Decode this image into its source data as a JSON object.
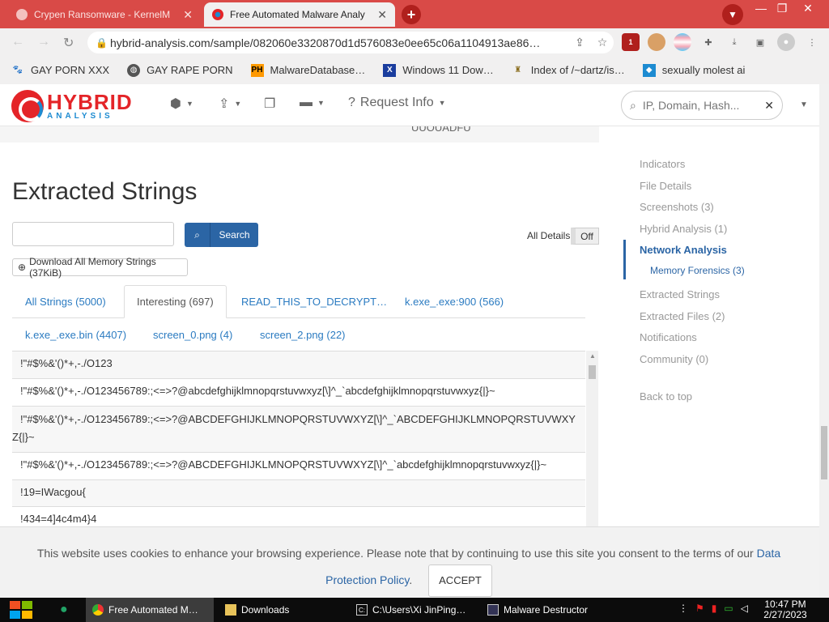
{
  "browser": {
    "tabs": [
      {
        "title": "Crypen Ransomware - KernelM",
        "active": false,
        "close": "✕"
      },
      {
        "title": "Free Automated Malware Analy",
        "active": true,
        "close": "✕"
      }
    ],
    "new_tab": "+",
    "url": "hybrid-analysis.com/sample/082060e3320870d1d576083e0ee65c06a1104913ae86…",
    "window_controls": {
      "minimize": "—",
      "restore": "❐",
      "close": "✕"
    },
    "extension_badge": "1",
    "bookmarks": [
      {
        "label": "GAY PORN XXX",
        "icon": "paw-icon"
      },
      {
        "label": "GAY RAPE PORN",
        "icon": "globe-icon"
      },
      {
        "label": "MalwareDatabase…",
        "icon": "ph-icon",
        "icon_text": "PH"
      },
      {
        "label": "Windows 11 Dow…",
        "icon": "x-icon",
        "icon_text": "X"
      },
      {
        "label": "Index of /~dartz/is…",
        "icon": "trophy-icon"
      },
      {
        "label": "sexually molest ai",
        "icon": "puzzle-icon"
      }
    ]
  },
  "site": {
    "logo_top": "HYBRID",
    "logo_bottom": "ANALYSIS",
    "menu": [
      {
        "icon": "cube-icon",
        "label": ""
      },
      {
        "icon": "file-upload-icon",
        "label": ""
      },
      {
        "icon": "copy-icon",
        "label": ""
      },
      {
        "icon": "folder-icon",
        "label": ""
      },
      {
        "icon": "question-circle-icon",
        "label": "Request Info"
      }
    ],
    "search_placeholder": "IP, Domain, Hash...",
    "search_clear": "✕"
  },
  "main": {
    "stub_text": "UUOUADFU",
    "heading": "Extracted Strings",
    "search_button": "Search",
    "all_details_label": "All Details:",
    "all_details_value": "Off",
    "download_button": "Download All Memory Strings (37KiB)",
    "tabs_row1": [
      {
        "label": "All Strings (5000)",
        "active": false
      },
      {
        "label": "Interesting (697)",
        "active": true
      },
      {
        "label": "READ_THIS_TO_DECRYPT…",
        "active": false
      },
      {
        "label": "k.exe_.exe:900 (566)",
        "active": false
      }
    ],
    "tabs_row2": [
      {
        "label": "k.exe_.exe.bin (4407)"
      },
      {
        "label": "screen_0.png (4)"
      },
      {
        "label": "screen_2.png (22)"
      }
    ],
    "strings": [
      "!\"#$%&'()*+,-./O123",
      "!\"#$%&'()*+,-./O123456789:;<=>?@abcdefghijklmnopqrstuvwxyz[\\]^_`abcdefghijklmnopqrstuvwxyz{|}~",
      "!\"#$%&'()*+,-./O123456789:;<=>?@ABCDEFGHIJKLMNOPQRSTUVWXYZ[\\]^_`ABCDEFGHIJKLMNOPQRSTUVWXYZ{|}~",
      "!\"#$%&'()*+,-./O123456789:;<=>?@ABCDEFGHIJKLMNOPQRSTUVWXYZ[\\]^_`abcdefghijklmnopqrstuvwxyz{|}~",
      "!19=IWacgou{",
      "!434=4]4c4m4}4"
    ]
  },
  "sidenav": {
    "items": [
      "Indicators",
      "File Details",
      "Screenshots (3)",
      "Hybrid Analysis (1)",
      "Network Analysis"
    ],
    "active": "Network Analysis",
    "sub_item": "Memory Forensics (3)",
    "items_after": [
      "Extracted Strings",
      "Extracted Files (2)",
      "Notifications",
      "Community (0)"
    ],
    "back_to_top": "Back to top"
  },
  "cookie": {
    "message": "This website uses cookies to enhance your browsing experience. Please note that by continuing to use this site you consent to the terms of our",
    "link": "Data Protection Policy",
    "period": ".",
    "accept": "ACCEPT"
  },
  "taskbar": {
    "items": [
      {
        "label": "Free Automated M…",
        "icon": "chrome-icon",
        "selected": true
      },
      {
        "label": "Downloads",
        "icon": "folder-icon",
        "selected": false
      },
      {
        "label": "C:\\Users\\Xi JinPing…",
        "icon": "terminal-icon",
        "selected": false
      },
      {
        "label": "Malware Destructor",
        "icon": "window-icon",
        "selected": false
      }
    ],
    "time": "10:47 PM",
    "date": "2/27/2023"
  },
  "colors": {
    "chrome_accent": "#d94a47",
    "link_blue": "#2b7bc1",
    "nav_active": "#2b65a5",
    "logo_red": "#e42428"
  }
}
